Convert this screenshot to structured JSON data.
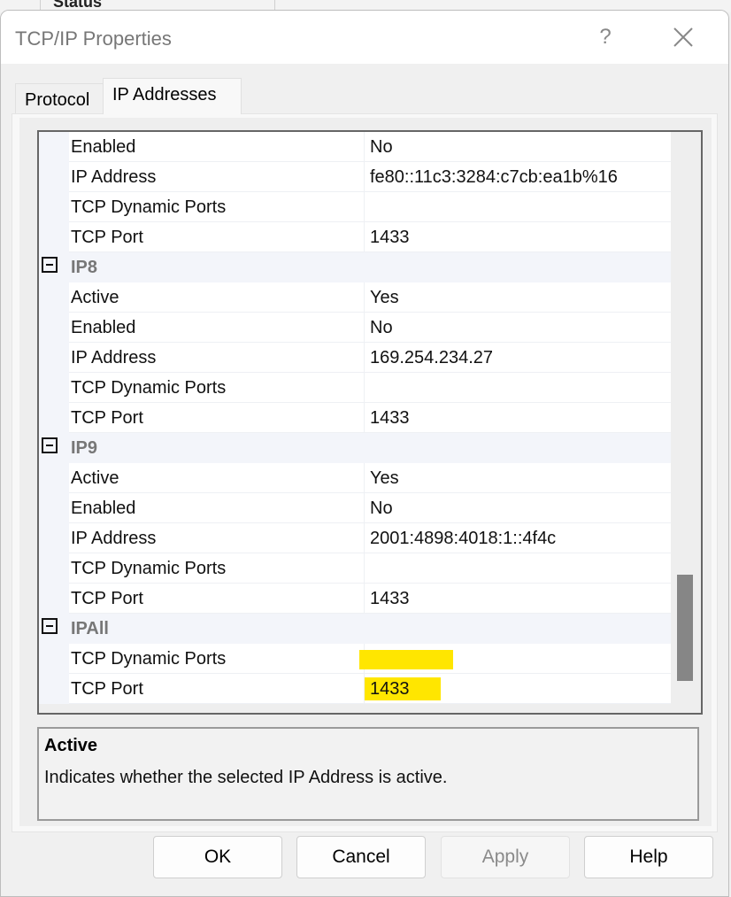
{
  "background_window": {
    "column_header": "Status"
  },
  "dialog": {
    "title": "TCP/IP Properties",
    "help_glyph": "?",
    "close_glyph": "close-icon"
  },
  "tabs": [
    {
      "label": "Protocol",
      "selected": false
    },
    {
      "label": "IP Addresses",
      "selected": true
    }
  ],
  "grid": {
    "rows": [
      {
        "type": "prop",
        "name": "Enabled",
        "value": "No"
      },
      {
        "type": "prop",
        "name": "IP Address",
        "value": "fe80::11c3:3284:c7cb:ea1b%16"
      },
      {
        "type": "prop",
        "name": "TCP Dynamic Ports",
        "value": ""
      },
      {
        "type": "prop",
        "name": "TCP Port",
        "value": "1433"
      },
      {
        "type": "cat",
        "name": "IP8"
      },
      {
        "type": "prop",
        "name": "Active",
        "value": "Yes"
      },
      {
        "type": "prop",
        "name": "Enabled",
        "value": "No"
      },
      {
        "type": "prop",
        "name": "IP Address",
        "value": "169.254.234.27"
      },
      {
        "type": "prop",
        "name": "TCP Dynamic Ports",
        "value": ""
      },
      {
        "type": "prop",
        "name": "TCP Port",
        "value": "1433"
      },
      {
        "type": "cat",
        "name": "IP9"
      },
      {
        "type": "prop",
        "name": "Active",
        "value": "Yes"
      },
      {
        "type": "prop",
        "name": "Enabled",
        "value": "No"
      },
      {
        "type": "prop",
        "name": "IP Address",
        "value": "2001:4898:4018:1::4f4c"
      },
      {
        "type": "prop",
        "name": "TCP Dynamic Ports",
        "value": ""
      },
      {
        "type": "prop",
        "name": "TCP Port",
        "value": "1433"
      },
      {
        "type": "cat",
        "name": "IPAll"
      },
      {
        "type": "prop",
        "name": "TCP Dynamic Ports",
        "value": "",
        "highlight": "dyn"
      },
      {
        "type": "prop",
        "name": "TCP Port",
        "value": "1433",
        "highlight": "port"
      }
    ],
    "highlight_color": "#ffe600"
  },
  "description": {
    "title": "Active",
    "text": "Indicates whether the selected IP Address is active."
  },
  "buttons": {
    "ok": "OK",
    "cancel": "Cancel",
    "apply": "Apply",
    "help": "Help"
  }
}
